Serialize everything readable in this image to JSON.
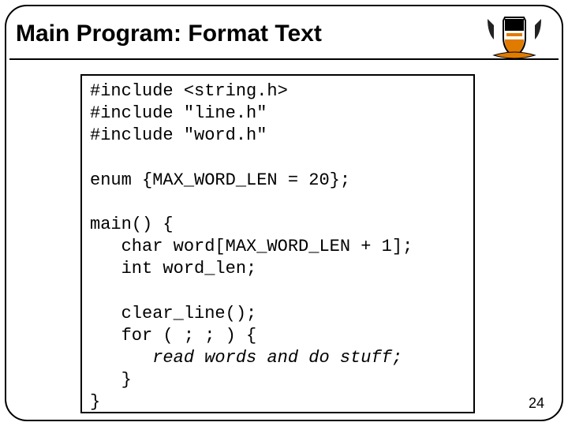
{
  "title": "Main Program: Format Text",
  "code": {
    "l1": "#include <string.h>",
    "l2": "#include \"line.h\"",
    "l3": "#include \"word.h\"",
    "blank1": "",
    "l4": "enum {MAX_WORD_LEN = 20};",
    "blank2": "",
    "l5": "main() {",
    "l6": "   char word[MAX_WORD_LEN + 1];",
    "l7": "   int word_len;",
    "blank3": "",
    "l8": "   clear_line();",
    "l9": "   for ( ; ; ) {",
    "l10_pre": "      ",
    "l10_ital": "read words and do stuff;",
    "l11": "   }",
    "l12": "}"
  },
  "page_number": "24"
}
